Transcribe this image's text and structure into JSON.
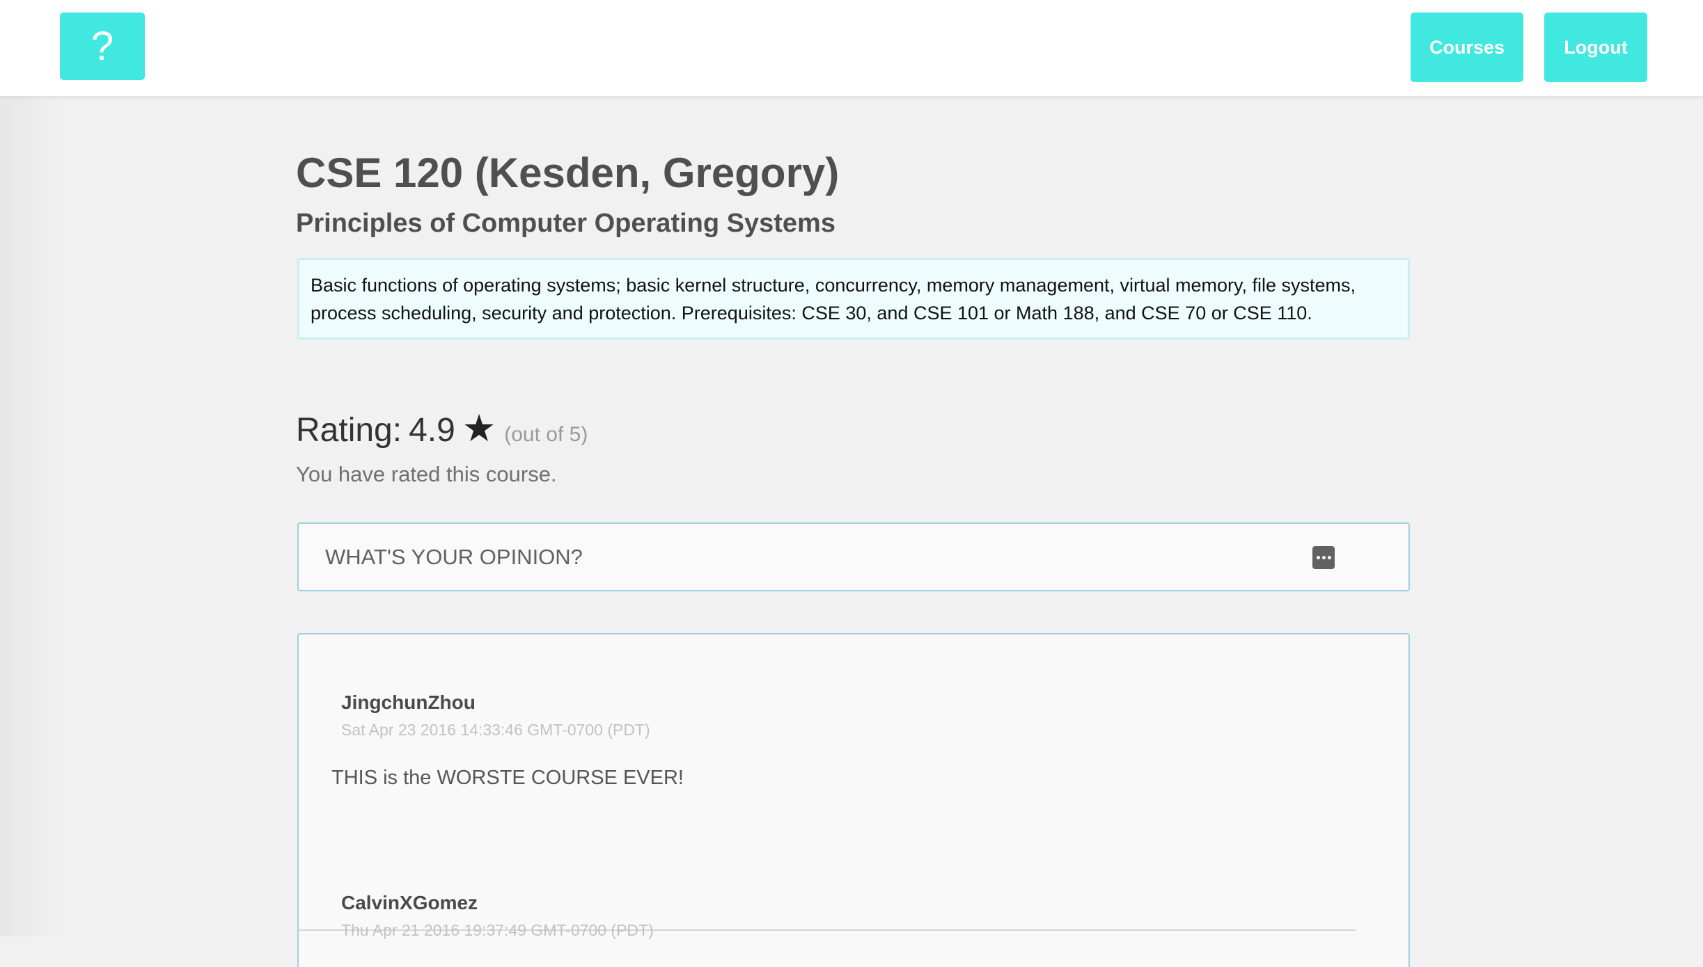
{
  "nav": {
    "help_label": "?",
    "courses_label": "Courses",
    "logout_label": "Logout",
    "accent_color": "#40e8df"
  },
  "course": {
    "title": "CSE 120 (Kesden, Gregory)",
    "subtitle": "Principles of Computer Operating Systems",
    "description": "Basic functions of operating systems; basic kernel structure, concurrency, memory management, virtual memory, file systems, process scheduling, security and protection. Prerequisites: CSE 30, and CSE 101 or Math 188, and CSE 70 or CSE 110."
  },
  "rating": {
    "label": "Rating:",
    "value": "4.9",
    "star": "★",
    "out_of": "(out of 5)",
    "rated_note": "You have rated this course."
  },
  "opinion": {
    "placeholder": "WHAT'S YOUR OPINION?",
    "more_icon": "ellipsis-icon"
  },
  "comments": [
    {
      "author": "JingchunZhou",
      "date": "Sat Apr 23 2016 14:33:46 GMT-0700 (PDT)",
      "body": "THIS is the WORSTE COURSE EVER!"
    },
    {
      "author": "CalvinXGomez",
      "date": "Thu Apr 21 2016 19:37:49 GMT-0700 (PDT)",
      "body": ""
    }
  ]
}
